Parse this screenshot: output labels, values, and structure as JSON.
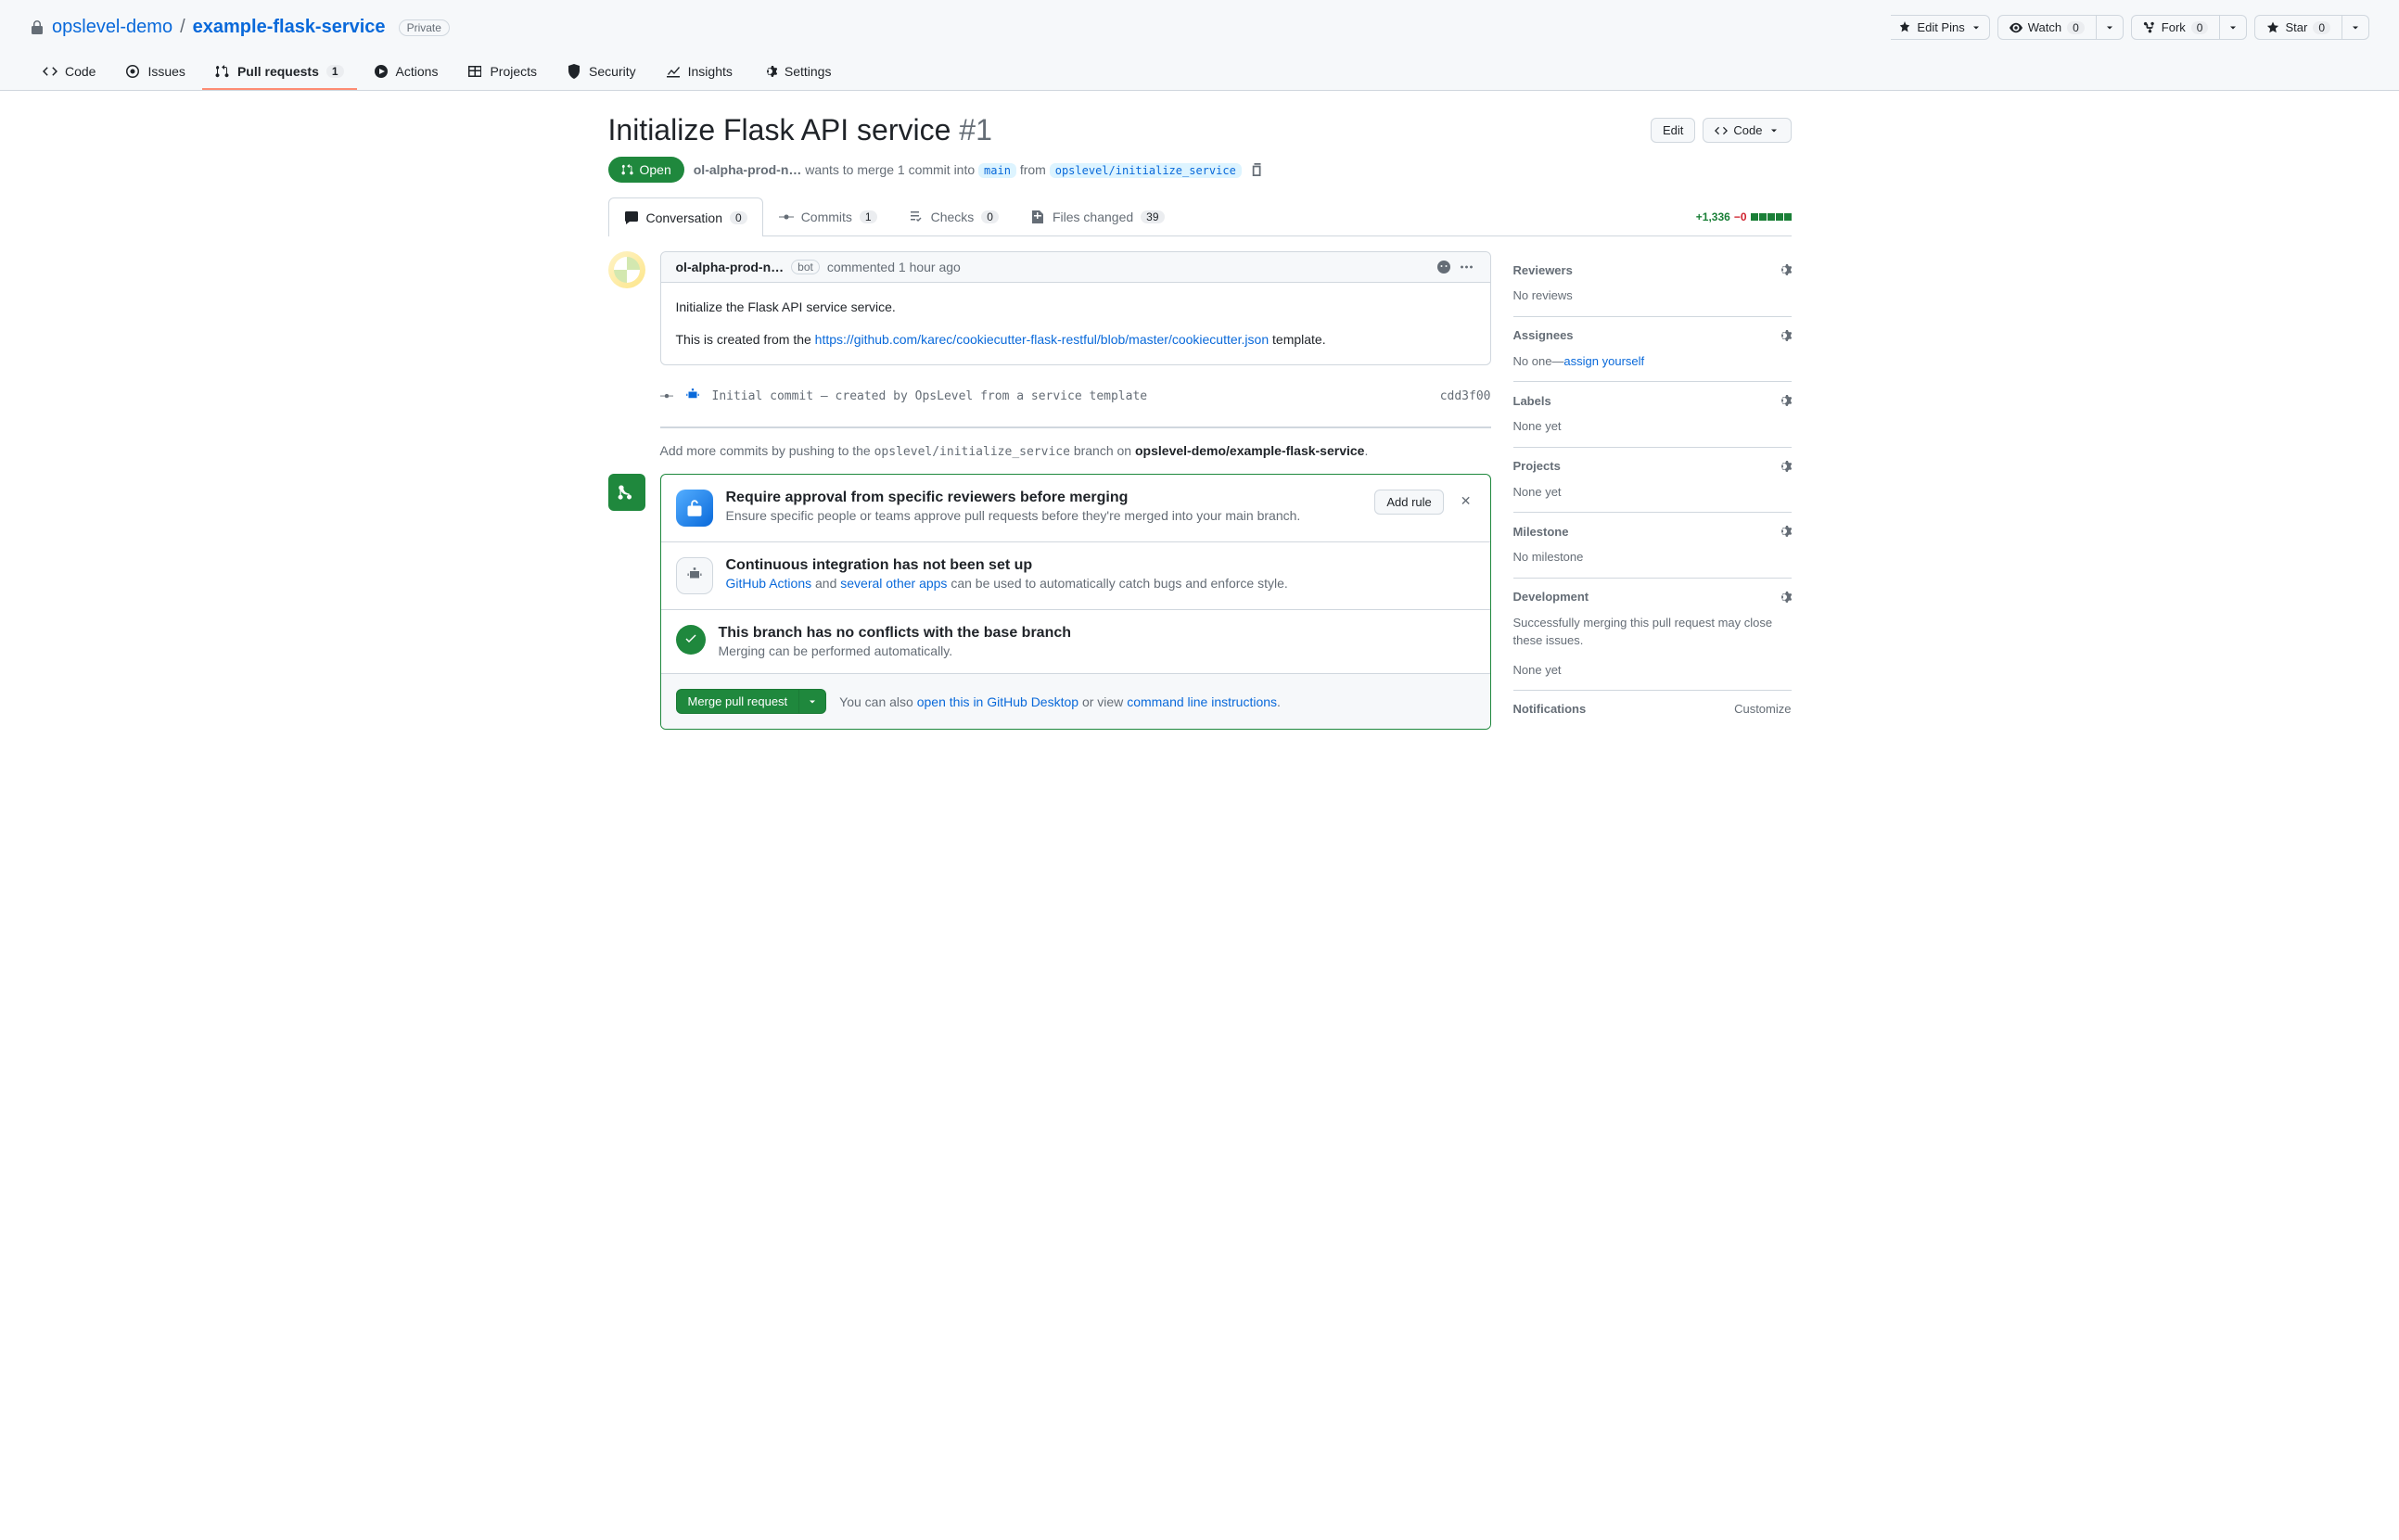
{
  "repo": {
    "owner": "opslevel-demo",
    "name": "example-flask-service",
    "visibility": "Private"
  },
  "repo_actions": {
    "edit_pins": "Edit Pins",
    "watch": "Watch",
    "watch_count": "0",
    "fork": "Fork",
    "fork_count": "0",
    "star": "Star",
    "star_count": "0"
  },
  "tabs": {
    "code": "Code",
    "issues": "Issues",
    "pulls": "Pull requests",
    "pulls_count": "1",
    "actions": "Actions",
    "projects": "Projects",
    "security": "Security",
    "insights": "Insights",
    "settings": "Settings"
  },
  "pr": {
    "title": "Initialize Flask API service",
    "number": "#1",
    "edit_btn": "Edit",
    "code_btn": "Code",
    "state": "Open",
    "author": "ol-alpha-prod-n…",
    "meta_text_1": "wants to merge 1 commit into",
    "base_branch": "main",
    "meta_text_2": "from",
    "head_branch": "opslevel/initialize_service"
  },
  "pr_tabs": {
    "conversation": "Conversation",
    "conversation_count": "0",
    "commits": "Commits",
    "commits_count": "1",
    "checks": "Checks",
    "checks_count": "0",
    "files": "Files changed",
    "files_count": "39"
  },
  "diffstat": {
    "additions": "+1,336",
    "deletions": "−0"
  },
  "comment": {
    "author": "ol-alpha-prod-n…",
    "bot_label": "bot",
    "time_prefix": "commented ",
    "time": "1 hour ago",
    "body_line1": "Initialize the Flask API service service.",
    "body_line2_a": "This is created from the ",
    "body_line2_link": "https://github.com/karec/cookiecutter-flask-restful/blob/master/cookiecutter.json",
    "body_line2_b": " template."
  },
  "commit": {
    "message": "Initial commit — created by OpsLevel from a service template",
    "sha": "cdd3f00"
  },
  "push_hint": {
    "prefix": "Add more commits by pushing to the ",
    "branch": "opslevel/initialize_service",
    "mid": " branch on ",
    "repo": "opslevel-demo/example-flask-service",
    "suffix": "."
  },
  "merge": {
    "protect_title": "Require approval from specific reviewers before merging",
    "protect_desc": "Ensure specific people or teams approve pull requests before they're merged into your main branch.",
    "add_rule": "Add rule",
    "ci_title": "Continuous integration has not been set up",
    "ci_link1": "GitHub Actions",
    "ci_and": " and ",
    "ci_link2": "several other apps",
    "ci_rest": " can be used to automatically catch bugs and enforce style.",
    "ok_title": "This branch has no conflicts with the base branch",
    "ok_desc": "Merging can be performed automatically.",
    "merge_btn": "Merge pull request",
    "footer_a": "You can also ",
    "footer_link1": "open this in GitHub Desktop",
    "footer_b": " or view ",
    "footer_link2": "command line instructions",
    "footer_c": "."
  },
  "sidebar": {
    "reviewers": {
      "title": "Reviewers",
      "body": "No reviews"
    },
    "assignees": {
      "title": "Assignees",
      "body_a": "No one—",
      "body_link": "assign yourself"
    },
    "labels": {
      "title": "Labels",
      "body": "None yet"
    },
    "projects": {
      "title": "Projects",
      "body": "None yet"
    },
    "milestone": {
      "title": "Milestone",
      "body": "No milestone"
    },
    "development": {
      "title": "Development",
      "body_a": "Successfully merging this pull request may close these issues.",
      "body_b": "None yet"
    },
    "notifications": {
      "title": "Notifications",
      "customize": "Customize"
    }
  }
}
